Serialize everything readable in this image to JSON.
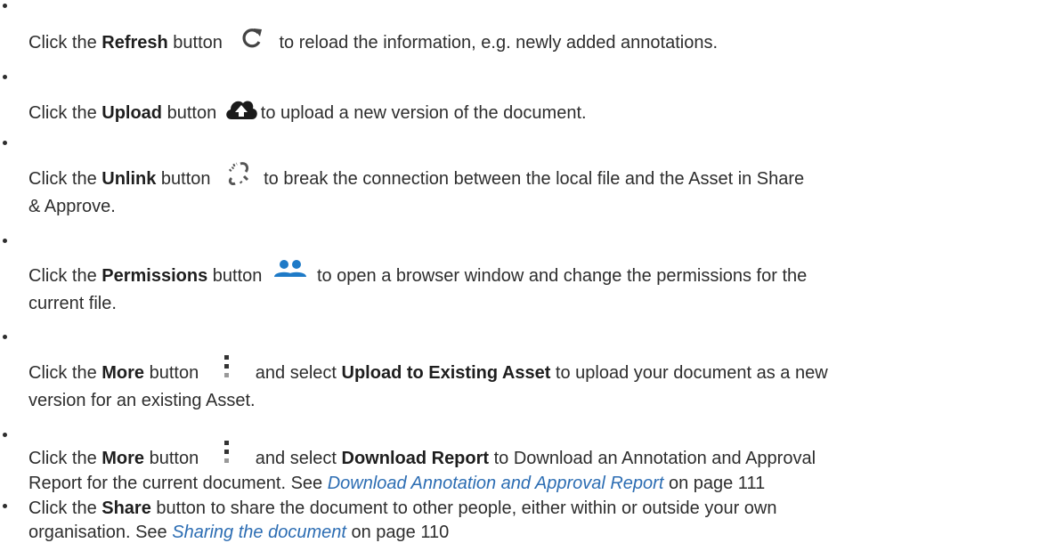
{
  "items": [
    {
      "prefix": "Click the ",
      "button_name": "Refresh",
      "mid": " button",
      "icon": "refresh-icon",
      "after_icon": "to reload the information, e.g. newly added annotations."
    },
    {
      "prefix": "Click the ",
      "button_name": "Upload",
      "mid": " button",
      "icon": "cloud-upload-icon",
      "after_icon": "to upload a new version of the document."
    },
    {
      "prefix": "Click the ",
      "button_name": "Unlink",
      "mid": " button",
      "icon": "unlink-icon",
      "after_icon": "to break the connection between the local file and the Asset in Share",
      "continuation": "& Approve."
    },
    {
      "prefix": "Click the ",
      "button_name": "Permissions",
      "mid": " button",
      "icon": "people-icon",
      "after_icon": "to open a browser window and change the permissions for the",
      "continuation": "current file."
    },
    {
      "prefix": "Click the ",
      "button_name": "More",
      "mid": " button",
      "icon": "more-vertical-icon",
      "after_icon": "and select ",
      "option_name": "Upload to Existing Asset",
      "after_option": " to upload your document as a new",
      "continuation": "version for an existing Asset."
    },
    {
      "prefix": "Click the ",
      "button_name": "More",
      "mid": " button",
      "icon": "more-vertical-icon",
      "after_icon": "and select ",
      "option_name": "Download Report",
      "after_option": " to Download an Annotation and Approval",
      "continuation_prefix": "Report for the current document. See ",
      "link_text": "Download Annotation and Approval Report",
      "link_suffix": " on page 111"
    },
    {
      "prefix": "Click the ",
      "button_name": "Share",
      "after_name": " button to share the document to other people, either within or outside your own",
      "continuation_prefix": "organisation. See ",
      "link_text": "Sharing the document",
      "link_suffix": " on page 110"
    }
  ],
  "colors": {
    "text": "#2d2d2d",
    "link": "#2c6db3",
    "icon_dark": "#1a1a1a",
    "icon_blue": "#1e7ac7"
  }
}
